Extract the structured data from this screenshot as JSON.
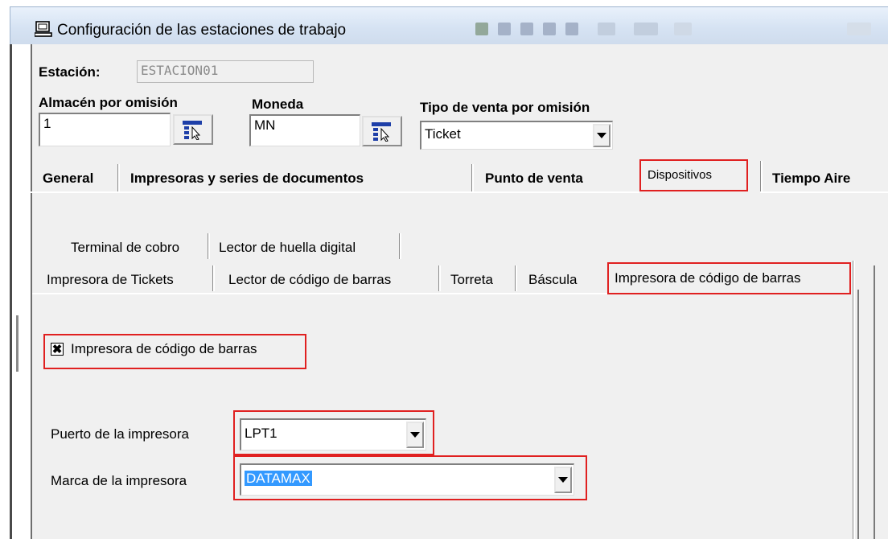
{
  "window": {
    "title": "Configuración de las estaciones de trabajo"
  },
  "station": {
    "label": "Estación:",
    "value": "ESTACION01"
  },
  "warehouse": {
    "label": "Almacén por omisión",
    "value": "1"
  },
  "currency": {
    "label": "Moneda",
    "value": "MN"
  },
  "sale_type": {
    "label": "Tipo de venta por omisión",
    "value": "Ticket"
  },
  "main_tabs": [
    {
      "label": "General"
    },
    {
      "label": "Impresoras  y series de documentos"
    },
    {
      "label": "Punto de venta"
    },
    {
      "label": "Dispositivos"
    },
    {
      "label": "Tiempo Aire"
    }
  ],
  "device_tabs_row1": [
    {
      "label": "Terminal de cobro"
    },
    {
      "label": "Lector de huella digital"
    }
  ],
  "device_tabs_row2": [
    {
      "label": "Impresora de Tickets"
    },
    {
      "label": "Lector de código de barras"
    },
    {
      "label": "Torreta"
    },
    {
      "label": "Báscula"
    },
    {
      "label": "Impresora de código de barras"
    }
  ],
  "barcode_printer": {
    "enabled_label": "Impresora de código de barras",
    "enabled": true,
    "port_label": "Puerto de la impresora",
    "port_value": "LPT1",
    "brand_label": "Marca de la impresora",
    "brand_value": "DATAMAX"
  },
  "colors": {
    "highlight": "#e02020",
    "selection": "#3399ff"
  },
  "icons": [
    "computer-icon",
    "lookup-icon",
    "dropdown-arrow-icon",
    "checkbox-check-icon"
  ]
}
